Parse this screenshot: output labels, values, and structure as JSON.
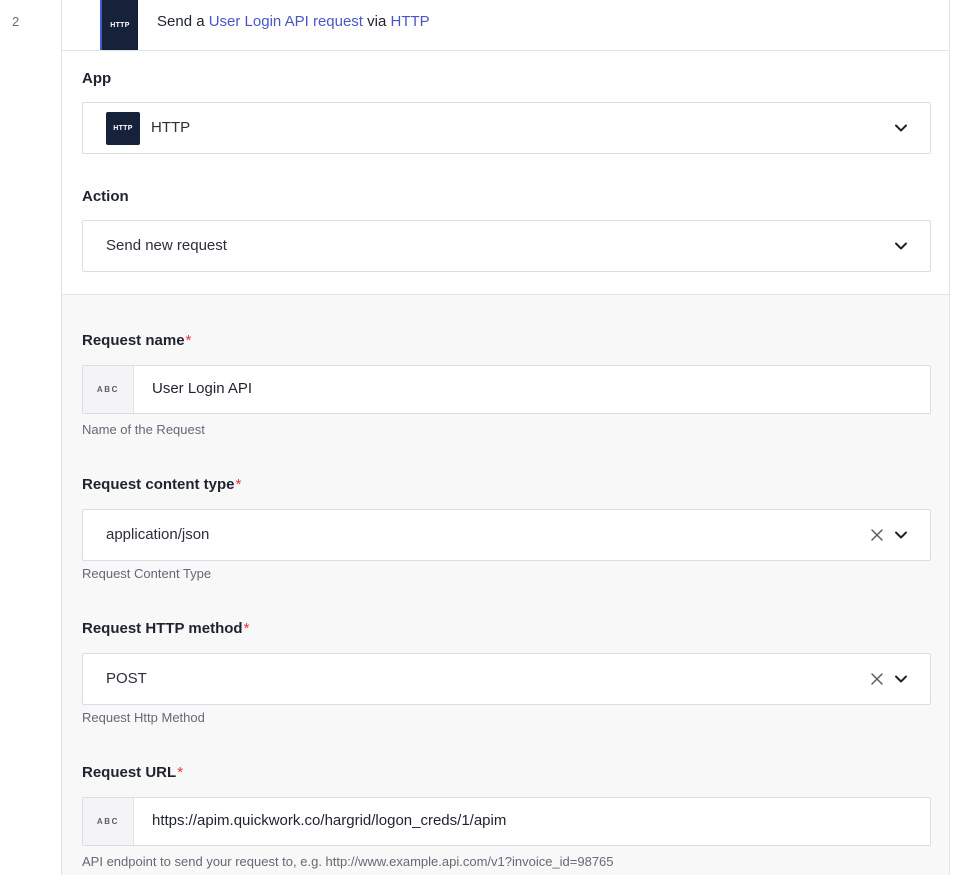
{
  "step": {
    "number": "2",
    "logo_text": "HTTP",
    "title_prefix": "Send a ",
    "title_action": "User Login API request",
    "title_middle": " via ",
    "title_app": "HTTP"
  },
  "app": {
    "label": "App",
    "logo_text": "HTTP",
    "value": "HTTP"
  },
  "action": {
    "label": "Action",
    "value": "Send new request"
  },
  "request_name": {
    "label": "Request name",
    "required_mark": "*",
    "badge": "ABC",
    "value": "User Login API",
    "hint": "Name of the Request"
  },
  "content_type": {
    "label": "Request content type",
    "required_mark": "*",
    "value": "application/json",
    "hint": "Request Content Type"
  },
  "http_method": {
    "label": "Request HTTP method",
    "required_mark": "*",
    "value": "POST",
    "hint": "Request Http Method"
  },
  "request_url": {
    "label": "Request URL",
    "required_mark": "*",
    "badge": "ABC",
    "value": "https://apim.quickwork.co/hargrid/logon_creds/1/apim",
    "hint": "API endpoint to send your request to, e.g. http://www.example.api.com/v1?invoice_id=98765"
  },
  "icons": {
    "chevron": "chevron-down-icon",
    "clear": "close-icon"
  },
  "colors": {
    "link": "#4a56c8",
    "required": "#e0353d",
    "logo_bg": "#16213a",
    "accent_border": "#3f5bd8"
  }
}
